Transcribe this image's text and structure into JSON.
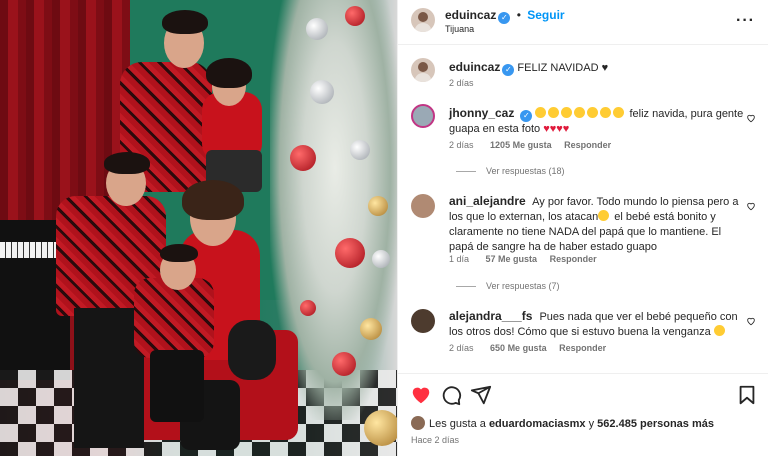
{
  "post": {
    "username": "eduincaz",
    "follow_label": "Seguir",
    "location": "Tijuana",
    "caption": "FELIZ NAVIDAD ♥",
    "caption_time": "2 días"
  },
  "comments": [
    {
      "username": "jhonny_caz",
      "text": "feliz navida, pura gente guapa en esta foto",
      "time": "2 días",
      "likes": "1205 Me gusta",
      "reply": "Responder",
      "view_replies": "Ver respuestas (18)"
    },
    {
      "username": "ani_alejandre",
      "text": "Ay por favor. Todo mundo lo piensa pero a los que lo externan, los atacan",
      "text2": " el bebé está bonito y claramente no tiene NADA del papá que lo mantiene. El papá de sangre ha de haber estado guapo",
      "time": "1 día",
      "likes": "57 Me gusta",
      "reply": "Responder",
      "view_replies": "Ver respuestas (7)"
    },
    {
      "username": "alejandra___fs",
      "text": "Pues nada que ver el bebé pequeño con los otros dos! Cómo que si estuvo buena la venganza",
      "time": "2 días",
      "likes": "650 Me gusta",
      "reply": "Responder"
    }
  ],
  "footer": {
    "likes_prefix": "Les gusta a ",
    "liker": "eduardomaciasmx",
    "likes_middle": " y ",
    "likes_count": "562.485 personas más",
    "time_ago": "Hace 2 días"
  },
  "colors": {
    "accent": "#0095f6",
    "verified": "#3897f0",
    "heart": "#ff3040"
  }
}
